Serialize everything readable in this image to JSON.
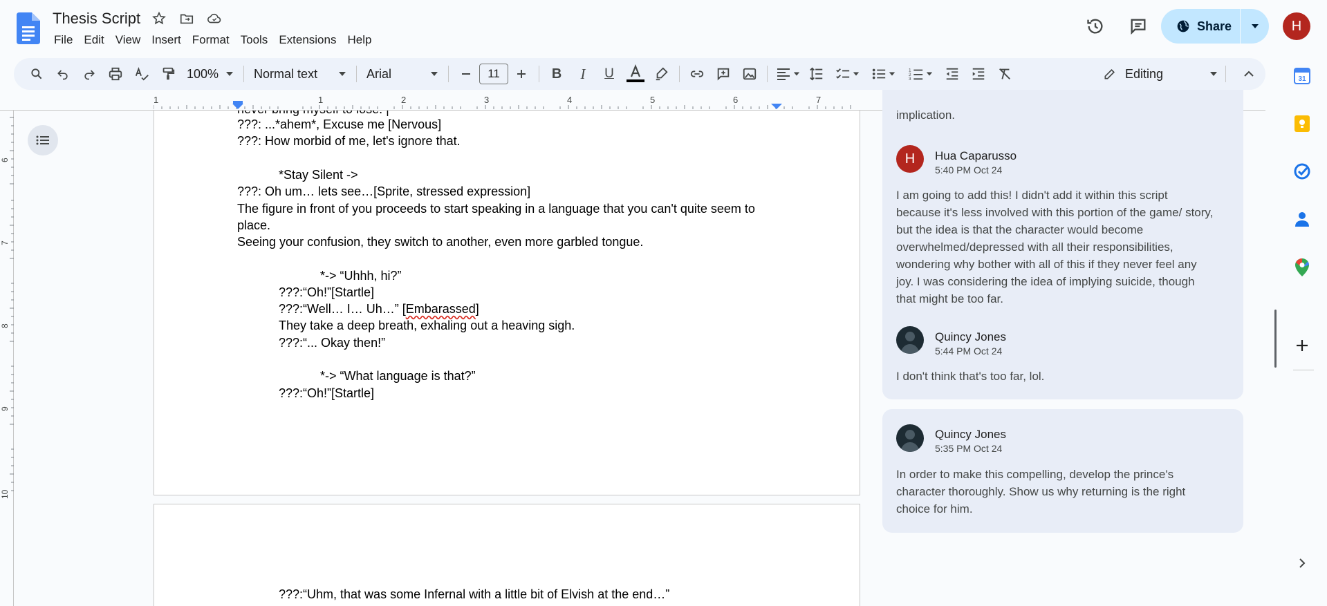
{
  "app": {
    "doc_title": "Thesis Script",
    "menu": [
      "File",
      "Edit",
      "View",
      "Insert",
      "Format",
      "Tools",
      "Extensions",
      "Help"
    ],
    "share_label": "Share",
    "user_initial": "H"
  },
  "toolbar": {
    "zoom": "100%",
    "style": "Normal text",
    "font": "Arial",
    "font_size": "11",
    "mode": "Editing"
  },
  "ruler": {
    "h_numbers": [
      "1",
      "1",
      "2",
      "3",
      "4",
      "5",
      "6",
      "7"
    ],
    "v_numbers": [
      "6",
      "7",
      "8",
      "9",
      "10"
    ]
  },
  "document": {
    "page1_lines": [
      "???: ...*ahem*, Excuse me [Nervous]",
      "???: How morbid of me, let's ignore that.",
      "*Stay Silent ->",
      "???: Oh um… lets see…[Sprite, stressed expression]",
      "The figure in front of you proceeds to start speaking in a language that you can't quite seem to",
      "place.",
      "Seeing your confusion, they switch to another, even more garbled tongue.",
      "*-> “Uhhh, hi?”",
      "???:“Oh!”[Startle]",
      "???:“Well… I… Uh…” [",
      "Embarassed",
      "]",
      "They take a deep breath, exhaling out a heaving sigh.",
      "???:“... Okay then!”",
      "*-> “What language is that?”",
      "???:“Oh!”[Startle]"
    ],
    "page2_lines": [
      "???:“Uhm, that was some Infernal with a little bit of Elvish at the end…”"
    ]
  },
  "comments": {
    "thread1": {
      "top_fragment": "implication.",
      "replies": [
        {
          "author": "Hua Caparusso",
          "time": "5:40 PM Oct 24",
          "initial": "H",
          "body": "I am going to add this! I didn't add it within this script because it's less involved with this portion of the game/ story, but the idea is that the character would become overwhelmed/depressed with all their responsibilities, wondering why bother with all of this if they never feel any joy. I was considering the idea of implying suicide, though that might be too far."
        },
        {
          "author": "Quincy Jones",
          "time": "5:44 PM Oct 24",
          "initial": "",
          "body": "I don't think that's too far, lol."
        }
      ]
    },
    "thread2": {
      "author": "Quincy Jones",
      "time": "5:35 PM Oct 24",
      "body": "In order to make this compelling, develop the prince's character thoroughly. Show us why returning is the right choice for him."
    }
  },
  "colors": {
    "accent": "#0b57d0",
    "share_bg": "#c2e7ff",
    "avatar_red": "#b3261e",
    "comment_bg": "#e8edf7"
  }
}
